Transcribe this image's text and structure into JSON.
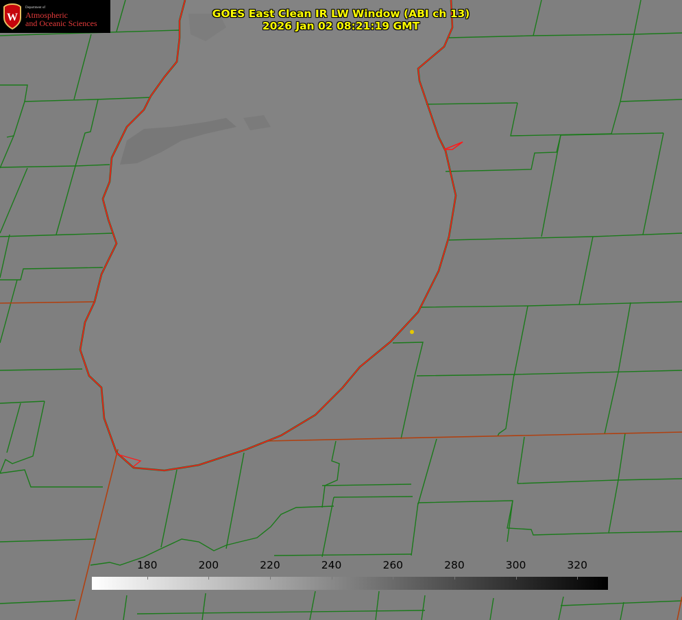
{
  "title": {
    "line1": "GOES East Clean IR LW Window (ABI ch 13)",
    "line2": "2026 Jan 02 08:21:19 GMT"
  },
  "logo": {
    "dept": "Department of",
    "line1": "Atmospheric",
    "line2": "and Oceanic Sciences",
    "icon": "uw-crest-icon"
  },
  "colorbar": {
    "min": 162,
    "max": 330,
    "ticks": [
      "180",
      "200",
      "220",
      "240",
      "260",
      "280",
      "300",
      "320"
    ],
    "tick_values": [
      180,
      200,
      220,
      240,
      260,
      280,
      300,
      320
    ],
    "low_color": "#ffffff",
    "high_color": "#000000"
  },
  "colors": {
    "background": "#7f7f7f",
    "lake": "#838383",
    "county_lines": "#1a7a1a",
    "state_lines": "#b04010",
    "shoreline": "#ff1a1a",
    "title": "#ffff00",
    "marker": "#e6c800"
  }
}
